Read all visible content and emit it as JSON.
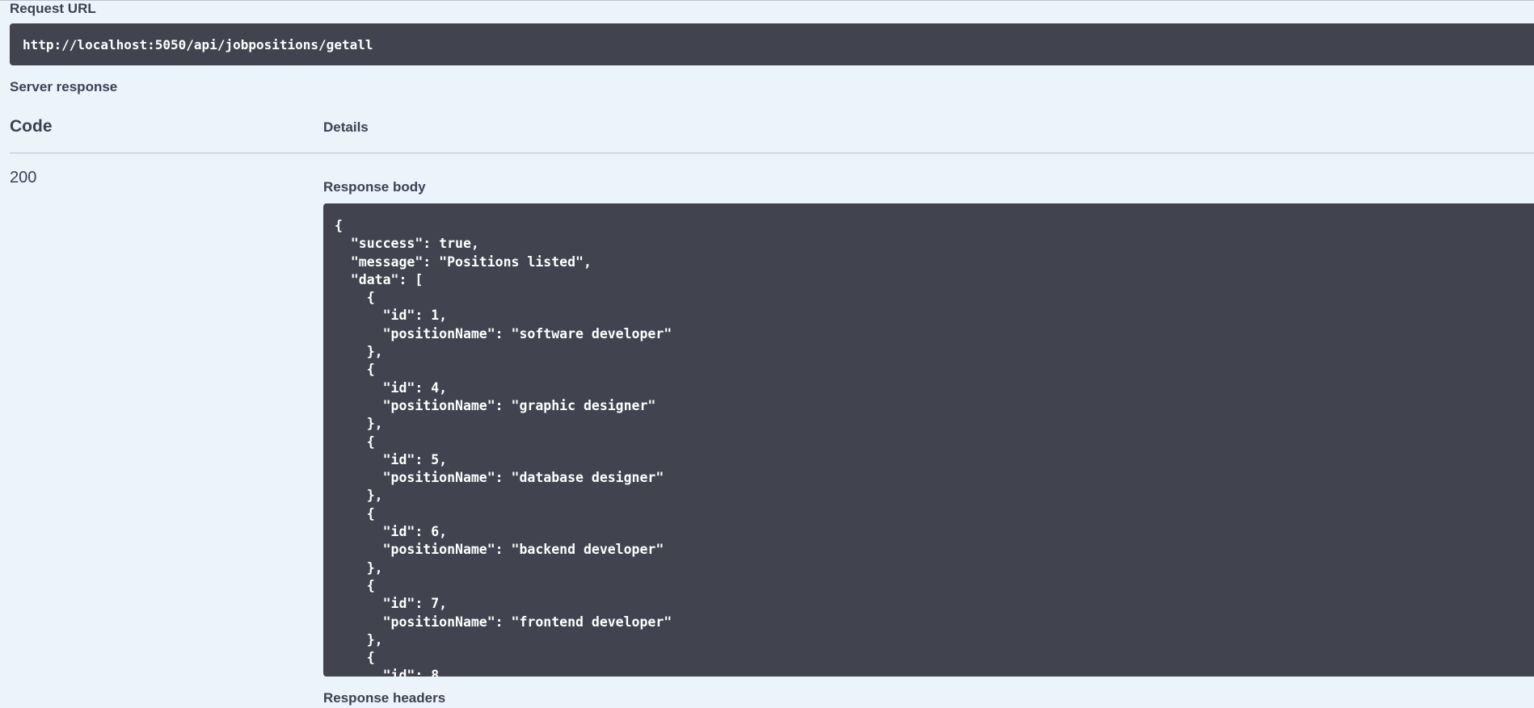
{
  "request_url": {
    "label": "Request URL",
    "value": "http://localhost:5050/api/jobpositions/getall"
  },
  "server_response": {
    "label": "Server response",
    "columns": {
      "code": "Code",
      "details": "Details"
    },
    "status_code": "200",
    "response_body_label": "Response body",
    "response_body": "{\n  \"success\": true,\n  \"message\": \"Positions listed\",\n  \"data\": [\n    {\n      \"id\": 1,\n      \"positionName\": \"software developer\"\n    },\n    {\n      \"id\": 4,\n      \"positionName\": \"graphic designer\"\n    },\n    {\n      \"id\": 5,\n      \"positionName\": \"database designer\"\n    },\n    {\n      \"id\": 6,\n      \"positionName\": \"backend developer\"\n    },\n    {\n      \"id\": 7,\n      \"positionName\": \"frontend developer\"\n    },\n    {\n      \"id\": 8,",
    "response_headers_label": "Response headers"
  },
  "colors": {
    "page_background": "#ebf3fb",
    "code_block_background": "#41444e",
    "text": "#3b4151",
    "code_text": "#ffffff"
  }
}
